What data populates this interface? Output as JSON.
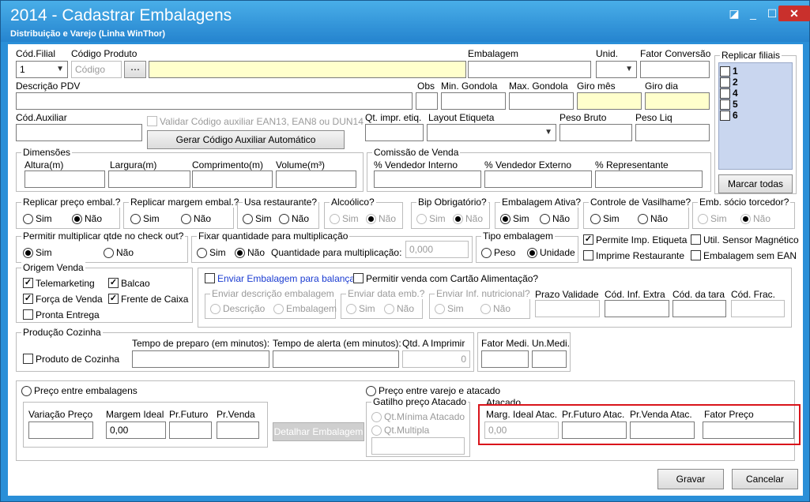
{
  "window": {
    "title": "2014 - Cadastrar Embalagens",
    "subtitle": "Distribuição e Varejo (Linha WinThor)"
  },
  "labels": {
    "cod_filial": "Cód.Filial",
    "cod_produto": "Código Produto",
    "embalagem": "Embalagem",
    "unid": "Unid.",
    "fator_conversao": "Fator Conversão",
    "descricao_pdv": "Descrição PDV",
    "obs": "Obs",
    "min_gondola": "Min. Gondola",
    "max_gondola": "Max. Gondola",
    "giro_mes": "Giro mês",
    "giro_dia": "Giro dia",
    "cod_auxiliar": "Cód.Auxiliar",
    "validar_cod": "Validar Código auxiliar EAN13, EAN8 ou DUN14",
    "qt_impr": "Qt. impr. etiq.",
    "layout_etiqueta": "Layout Etiqueta",
    "peso_bruto": "Peso Bruto",
    "peso_liq": "Peso Liq"
  },
  "filial_value": "1",
  "codigo_placeholder": "Código",
  "btn_gerar": "Gerar Código Auxiliar Automático",
  "replicar": {
    "title": "Replicar filiais",
    "items": [
      "1",
      "2",
      "4",
      "5",
      "6"
    ],
    "btn": "Marcar todas"
  },
  "dimensoes": {
    "title": "Dimensões",
    "fields": [
      "Altura(m)",
      "Largura(m)",
      "Comprimento(m)",
      "Volume(m³)"
    ]
  },
  "comissao": {
    "title": "Comissão de Venda",
    "fields": [
      "% Vendedor Interno",
      "% Vendedor Externo",
      "% Representante"
    ]
  },
  "sim": "Sim",
  "nao": "Não",
  "yn": {
    "g1": "Replicar preço embal.?",
    "g2": "Replicar margem embal.?",
    "g3": "Usa restaurante?",
    "g4": "Alcoólico?",
    "g5": "Bip Obrigatório?",
    "g6": "Embalagem Ativa?",
    "g7": "Controle de Vasilhame?",
    "g8": "Emb. sócio torcedor?"
  },
  "permitir_mult": "Permitir multiplicar qtde no check out?",
  "fixar": {
    "title": "Fixar quantidade para multiplicação",
    "qtd_label": "Quantidade para multiplicação:",
    "qtd_value": "0,000"
  },
  "tipo": {
    "title": "Tipo embalagem",
    "peso": "Peso",
    "unidade": "Unidade"
  },
  "chk": {
    "permite_imp": "Permite Imp. Etiqueta",
    "util_sensor": "Util. Sensor Magnético",
    "imprime_rest": "Imprime Restaurante",
    "sem_ean": "Embalagem sem EAN"
  },
  "origem": {
    "title": "Origem Venda",
    "telemarketing": "Telemarketing",
    "balcao": "Balcao",
    "forca": "Força de Venda",
    "frente": "Frente de Caixa",
    "pronta": "Pronta Entrega"
  },
  "balanca": {
    "enviar": "Enviar Embalagem para balança",
    "permitir_cartao": "Permitir venda com Cartão Alimentação?",
    "desc_title": "Enviar descrição embalagem",
    "descricao": "Descrição",
    "embalagem": "Embalagem",
    "data_title": "Enviar data emb.?",
    "inf_title": "Enviar Inf. nutricional?",
    "prazo": "Prazo Validade",
    "inf_extra": "Cód. Inf. Extra",
    "tara": "Cód. da tara",
    "frac": "Cód. Frac."
  },
  "producao": {
    "title": "Produção Cozinha",
    "produto": "Produto de Cozinha",
    "tempo_preparo": "Tempo de preparo (em minutos):",
    "tempo_alerta": "Tempo de alerta (em minutos):",
    "qtd_imprimir": "Qtd. A Imprimir",
    "qtd_value": "0",
    "fator_medi": "Fator Medi.",
    "un_medi": "Un.Medi."
  },
  "preco": {
    "entre_emb": "Preço entre embalagens",
    "variacao": "Variação Preço",
    "margem_ideal": "Margem Ideal",
    "margem_value": "0,00",
    "pr_futuro": "Pr.Futuro",
    "pr_venda": "Pr.Venda",
    "detalhar": "Detalhar Embalagem",
    "entre_varejo": "Preço entre varejo e atacado",
    "gatilho": "Gatilho preço Atacado",
    "qt_minima": "Qt.Mínima Atacado",
    "qt_multipla": "Qt.Multipla",
    "atacado": "Atacado",
    "marg_ideal_atac": "Marg. Ideal Atac.",
    "marg_atac_value": "0,00",
    "pr_futuro_atac": "Pr.Futuro Atac.",
    "pr_venda_atac": "Pr.Venda Atac.",
    "fator_preco": "Fator Preço"
  },
  "footer": {
    "gravar": "Gravar",
    "cancelar": "Cancelar"
  }
}
